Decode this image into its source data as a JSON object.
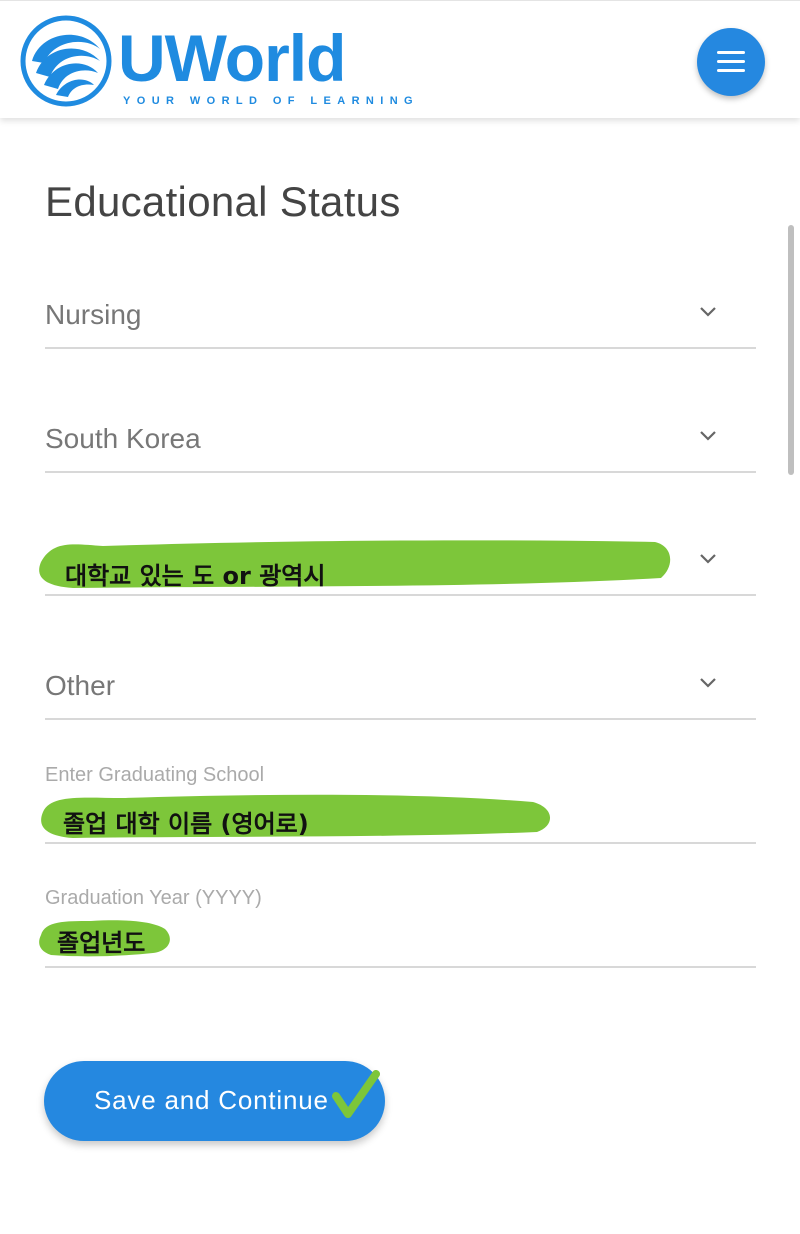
{
  "header": {
    "logo_text": "UWorld",
    "logo_tagline": "YOUR WORLD OF LEARNING",
    "menu_icon": "hamburger-menu-icon"
  },
  "page": {
    "title": "Educational Status"
  },
  "form": {
    "program_select": {
      "value": "Nursing"
    },
    "country_select": {
      "value": "South Korea"
    },
    "region_select": {
      "value": "대학교 있는 도 or 광역시"
    },
    "school_type_select": {
      "value": "Other"
    },
    "graduating_school": {
      "label": "Enter Graduating School",
      "value": "졸업 대학 이름 (영어로)"
    },
    "graduation_year": {
      "label": "Graduation Year (YYYY)",
      "value": "졸업년도"
    }
  },
  "actions": {
    "save_label": "Save and Continue"
  },
  "colors": {
    "brand": "#1f8be0",
    "button": "#2588e0",
    "highlighter": "#7dc63a"
  }
}
